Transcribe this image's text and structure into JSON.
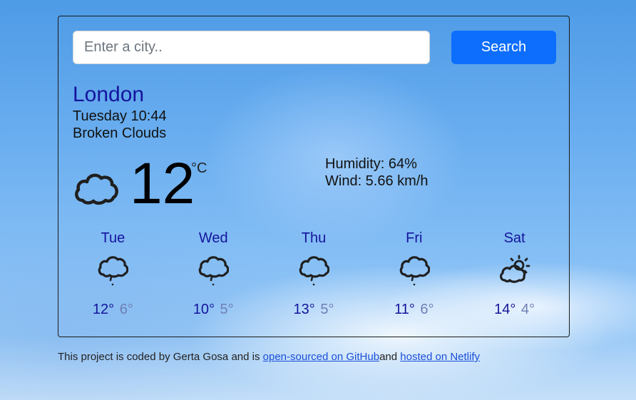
{
  "search": {
    "placeholder": "Enter a city..",
    "value": "",
    "button_label": "Search"
  },
  "current": {
    "city": "London",
    "datetime": "Tuesday 10:44",
    "description": "Broken Clouds",
    "icon": "cloud-icon",
    "temperature": "12",
    "unit": "°C",
    "humidity": "Humidity: 64%",
    "wind": "Wind: 5.66 km/h"
  },
  "forecast": [
    {
      "day": "Tue",
      "icon": "cloud-rain-icon",
      "max": "12°",
      "min": "6°"
    },
    {
      "day": "Wed",
      "icon": "cloud-rain-icon",
      "max": "10°",
      "min": "5°"
    },
    {
      "day": "Thu",
      "icon": "cloud-rain-icon",
      "max": "13°",
      "min": "5°"
    },
    {
      "day": "Fri",
      "icon": "cloud-rain-icon",
      "max": "11°",
      "min": "6°"
    },
    {
      "day": "Sat",
      "icon": "sun-cloud-icon",
      "max": "14°",
      "min": "4°"
    }
  ],
  "footer": {
    "text_before": "This project is coded by Gerta Gosa and is ",
    "github_link": "open-sourced on GitHub",
    "text_middle": "and ",
    "netlify_link": "hosted on Netlify"
  },
  "colors": {
    "button": "#0d6efd",
    "accent_text": "#14149c",
    "min_temp": "#6f7fb5"
  }
}
